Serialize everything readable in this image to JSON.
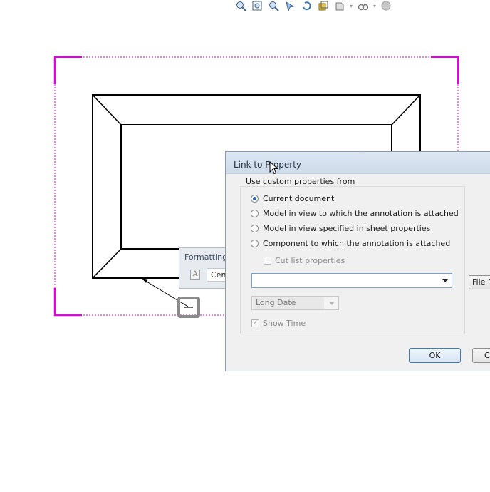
{
  "toolbar": {
    "icons": [
      "zoom-to-fit-icon",
      "zoom-to-area-icon",
      "zoom-in-out-icon",
      "select-icon",
      "rotate-view-icon",
      "3d-view-icon",
      "display-style-icon",
      "hide-show-icon",
      "appearance-icon"
    ]
  },
  "formatting_toolbar": {
    "title": "Formatting",
    "font_value": "Cen"
  },
  "dialog": {
    "title": "Link to Property",
    "group_label": "Use custom properties from",
    "options": [
      {
        "label": "Current document",
        "selected": true
      },
      {
        "label": "Model in view to which the annotation is attached",
        "selected": false
      },
      {
        "label": "Model in view specified in sheet properties",
        "selected": false
      },
      {
        "label": "Component to which the annotation is attached",
        "selected": false
      }
    ],
    "cut_list_label": "Cut list properties",
    "property_value": "",
    "file_button": "File P",
    "date_format": "Long Date",
    "show_time_label": "Show Time",
    "ok_label": "OK",
    "cancel_label": "C"
  },
  "colors": {
    "sheet_border": "#e600e6",
    "dialog_caption": "#d6e1ef",
    "ok_border": "#3d7bbf"
  }
}
